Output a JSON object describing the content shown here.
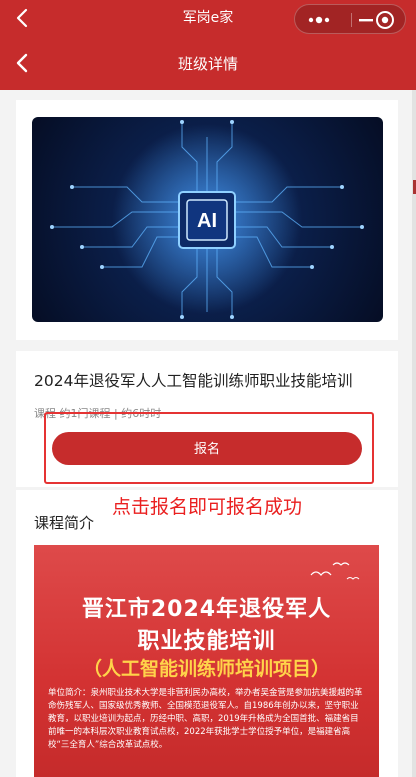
{
  "topbar": {
    "title": "军岗e家"
  },
  "navbar": {
    "title": "班级详情"
  },
  "banner": {
    "ai_label": "AI"
  },
  "course": {
    "title": "2024年退役军人人工智能训练师职业技能培训",
    "meta": "课程 约1门课程 | 约6时时",
    "signup_label": "报名"
  },
  "annotation": {
    "text": "点击报名即可报名成功"
  },
  "intro": {
    "heading": "课程简介",
    "poster": {
      "line1": "晋江市2024年退役军人",
      "line2": "职业技能培训",
      "line3": "（人工智能训练师培训项目）",
      "body": "单位简介：泉州职业技术大学是非营利民办高校，举办者吴金营是参加抗美援越的革命伤残军人、国家级优秀教师、全国模范退役军人。自1986年创办以来，坚守职业教育，以职业培训为起点，历经中职、高职，2019年升格成为全国首批、福建省目前唯一的本科层次职业教育试点校，2022年获批学士学位授予单位，是福建省高校“三全育人”综合改革试点校。"
    }
  },
  "colors": {
    "brand_red": "#c62c2c",
    "annotation_red": "#e53333",
    "poster_yellow": "#ffd34a"
  }
}
